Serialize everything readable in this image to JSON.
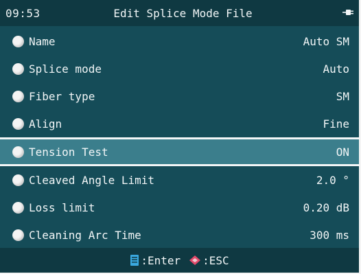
{
  "header": {
    "time": "09:53",
    "title": "Edit Splice Mode File",
    "power_icon": "plug-icon"
  },
  "rows": [
    {
      "label": "Name",
      "value": "Auto SM"
    },
    {
      "label": "Splice mode",
      "value": "Auto"
    },
    {
      "label": "Fiber type",
      "value": "SM"
    },
    {
      "label": "Align",
      "value": "Fine"
    },
    {
      "label": "Tension Test",
      "value": "ON",
      "selected": true
    },
    {
      "label": "Cleaved Angle Limit",
      "value": "2.0 °"
    },
    {
      "label": "Loss limit",
      "value": "0.20 dB"
    },
    {
      "label": "Cleaning Arc Time",
      "value": "300 ms"
    }
  ],
  "footer": {
    "enter_label": ":Enter",
    "enter_icon": "enter-icon",
    "esc_label": ":ESC",
    "esc_icon": "esc-diamond-icon"
  },
  "colors": {
    "background": "#154c58",
    "titlebar": "#0f3942",
    "selected_row": "#3b7e8c",
    "enter_icon": "#3aa9e0",
    "esc_icon": "#e24a6a"
  }
}
